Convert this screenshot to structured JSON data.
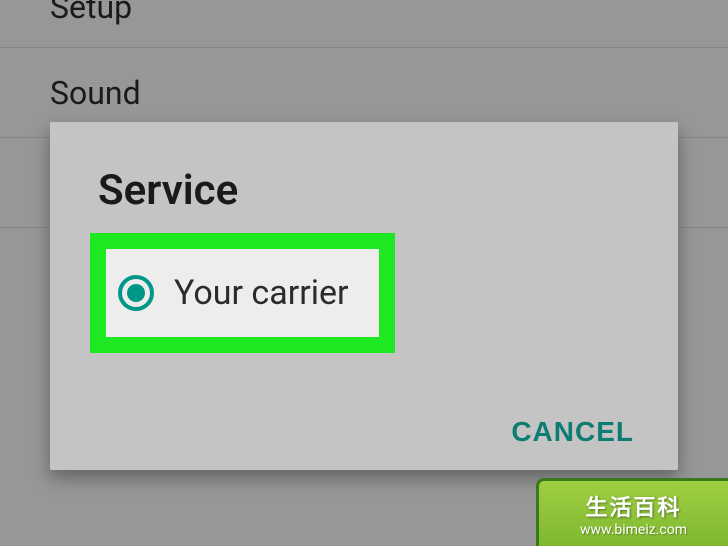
{
  "background": {
    "items": [
      {
        "label": "Setup"
      },
      {
        "label": "Sound"
      },
      {
        "label": ""
      }
    ]
  },
  "dialog": {
    "title": "Service",
    "option": {
      "label": "Your carrier",
      "selected": true
    },
    "cancel_label": "CANCEL"
  },
  "watermark": {
    "title_text": "生活百科",
    "url_text": "www.bimeiz.com"
  }
}
